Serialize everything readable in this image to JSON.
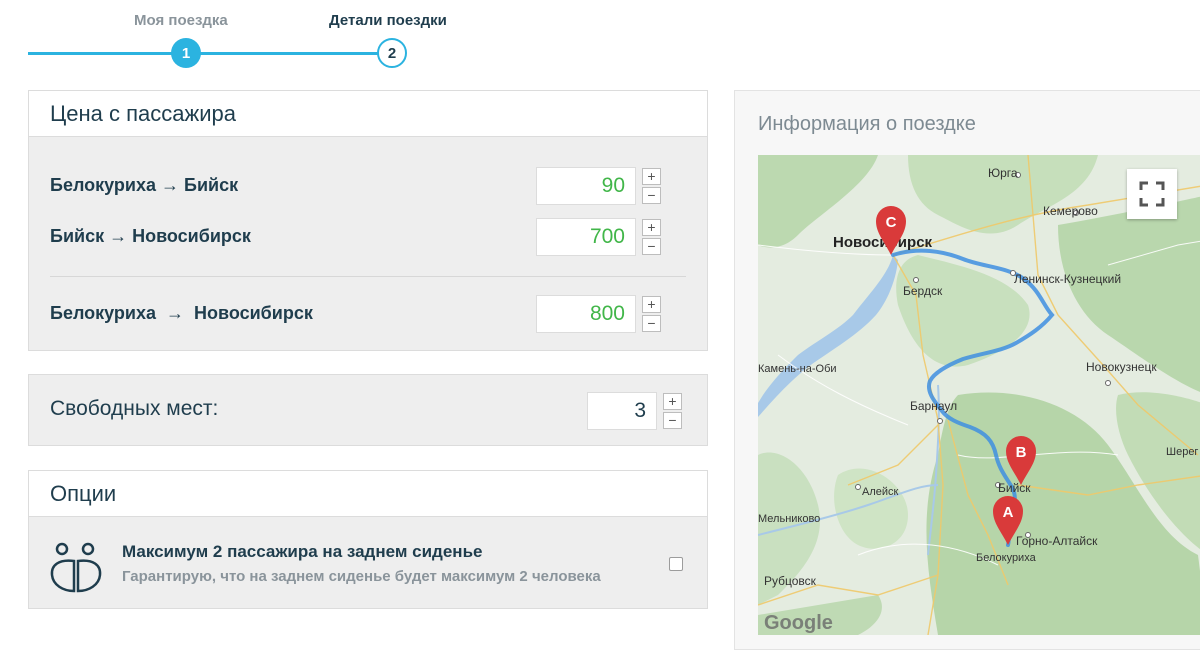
{
  "stepper": {
    "step1": {
      "label": "Моя поездка",
      "number": "1"
    },
    "step2": {
      "label": "Детали поездки",
      "number": "2"
    }
  },
  "price": {
    "title": "Цена с пассажира",
    "rows": [
      {
        "label": "Белокуриха → Бийск",
        "value": "90"
      },
      {
        "label": "Бийск → Новосибирск",
        "value": "700"
      },
      {
        "label": "Белокуриха  →  Новосибирск",
        "value": "800"
      }
    ],
    "plus": "+",
    "minus": "−"
  },
  "seats": {
    "label": "Свободных мест:",
    "value": "3"
  },
  "options": {
    "title": "Опции",
    "item": {
      "title": "Максимум 2 пассажира на заднем сиденье",
      "subtitle": "Гарантирую, что на заднем сиденье будет максимум 2 человека",
      "checked": false
    }
  },
  "info": {
    "title": "Информация о поездке",
    "map": {
      "cities": {
        "yurga": "Юрга",
        "kemerovo": "Кемерово",
        "novosibirsk": "Новосибирск",
        "berdsk": "Бердск",
        "leninsk": "Ленинск-Кузнецкий",
        "kamen": "Камень-на-Оби",
        "novokuznetsk": "Новокузнецк",
        "barnaul": "Барнаул",
        "sheregesh": "Шерег",
        "aleysk": "Алейск",
        "biysk": "Бийск",
        "melnikovo": "Мельниково",
        "gorno": "Горно-Алтайск",
        "belokurikha": "Белокуриха",
        "rubtsovsk": "Рубцовск"
      },
      "markers": {
        "a": "A",
        "b": "B",
        "c": "C"
      },
      "logo": "Google",
      "route_color": "#4a90e2",
      "marker_color": "#d93a3a"
    }
  }
}
